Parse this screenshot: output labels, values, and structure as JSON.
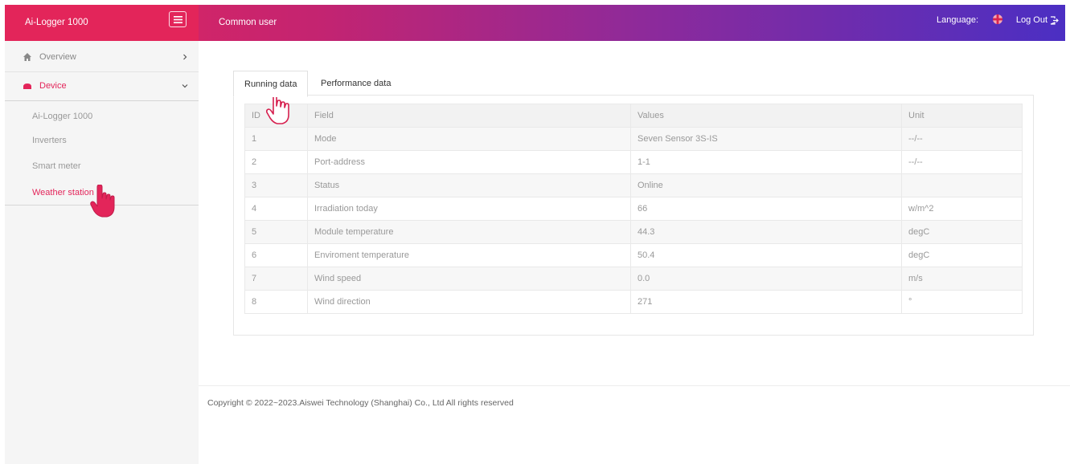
{
  "header": {
    "brand": "Ai-Logger 1000",
    "user_role": "Common user",
    "language_label": "Language:",
    "logout_label": "Log Out"
  },
  "sidebar": {
    "items": [
      {
        "label": "Overview",
        "icon": "home-icon",
        "expanded": false
      },
      {
        "label": "Device",
        "icon": "device-icon",
        "expanded": true
      }
    ],
    "device_subitems": [
      "Ai-Logger 1000",
      "Inverters",
      "Smart meter",
      "Weather station"
    ],
    "active_subitem": "Weather station"
  },
  "tabs": [
    {
      "label": "Running data",
      "active": true
    },
    {
      "label": "Performance data",
      "active": false
    }
  ],
  "table": {
    "columns": [
      "ID",
      "Field",
      "Values",
      "Unit"
    ],
    "rows": [
      [
        "1",
        "Mode",
        "Seven Sensor 3S-IS",
        "--/--"
      ],
      [
        "2",
        "Port-address",
        "1-1",
        "--/--"
      ],
      [
        "3",
        "Status",
        "Online",
        ""
      ],
      [
        "4",
        "Irradiation today",
        "66",
        "w/m^2"
      ],
      [
        "5",
        "Module temperature",
        "44.3",
        "degC"
      ],
      [
        "6",
        "Enviroment temperature",
        "50.4",
        "degC"
      ],
      [
        "7",
        "Wind speed",
        "0.0",
        "m/s"
      ],
      [
        "8",
        "Wind direction",
        "271",
        "°"
      ]
    ]
  },
  "footer": {
    "copyright": "Copyright © 2022~2023.Aiswei Technology (Shanghai) Co., Ltd All rights reserved"
  },
  "colors": {
    "accent": "#e3255a",
    "header_gradient_end": "#4b2fc3"
  }
}
